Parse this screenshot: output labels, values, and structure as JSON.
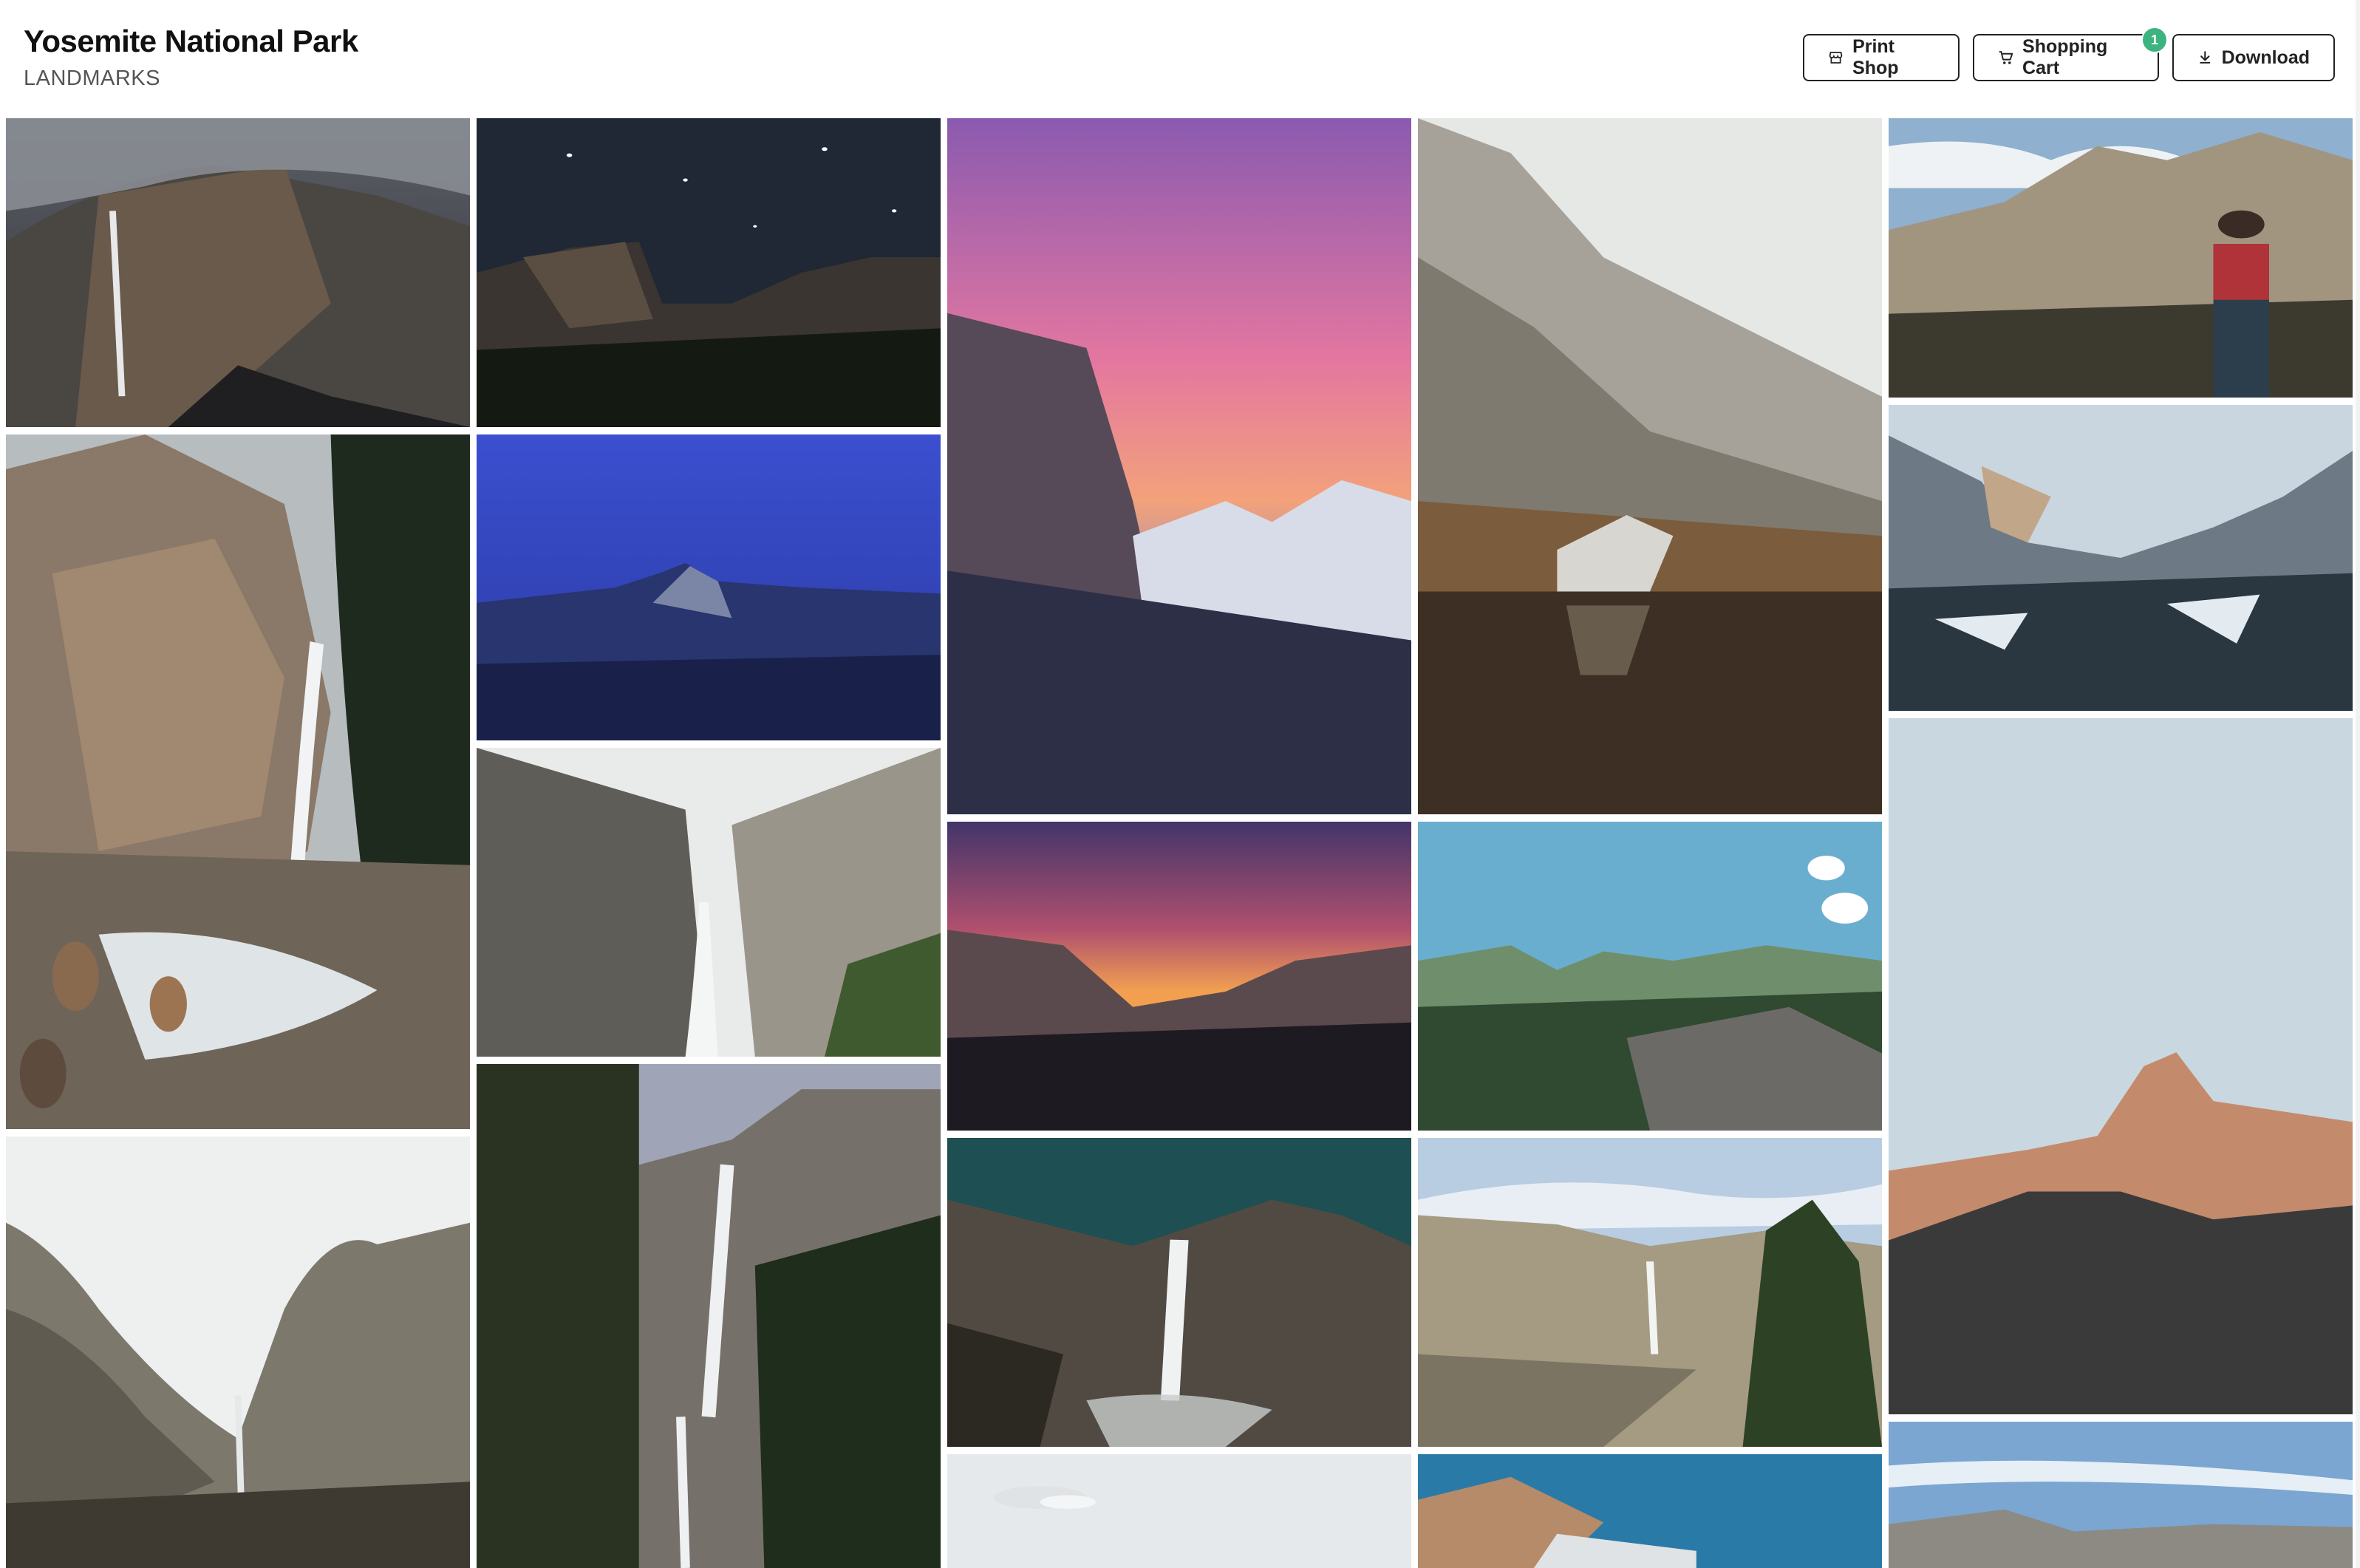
{
  "header": {
    "title": "Yosemite National Park",
    "subtitle": "LANDMARKS"
  },
  "actions": {
    "print_shop": {
      "label": "Print Shop",
      "icon": "storefront-icon"
    },
    "shopping_cart": {
      "label": "Shopping Cart",
      "icon": "cart-icon",
      "count": "1"
    },
    "download": {
      "label": "Download",
      "icon": "download-icon"
    }
  },
  "colors": {
    "badge": "#3bb47f",
    "border": "#222222"
  },
  "photos": [
    "Yosemite Falls in clouds",
    "El Capitan at night under stars",
    "El Capitan at pink sunset",
    "Granite cliff above reflective pond",
    "Hiker photographing Half Dome",
    "Lower Yosemite Fall with boulders",
    "Half Dome at blue hour",
    "Snowy Tunnel View valley",
    "Waterfall through granite gorge",
    "Tunnel View at sunset",
    "Valley and granite dome under blue sky",
    "Half Dome at golden hour",
    "Bridalveil Fall in misty valley",
    "Upper and Lower Yosemite Falls through trees",
    "Yosemite Falls under starry teal sky",
    "Yosemite Falls from a granite ridge",
    "Pale sky over treetops",
    "Granite wall under deep blue sky",
    "Valley under wispy clouds"
  ]
}
